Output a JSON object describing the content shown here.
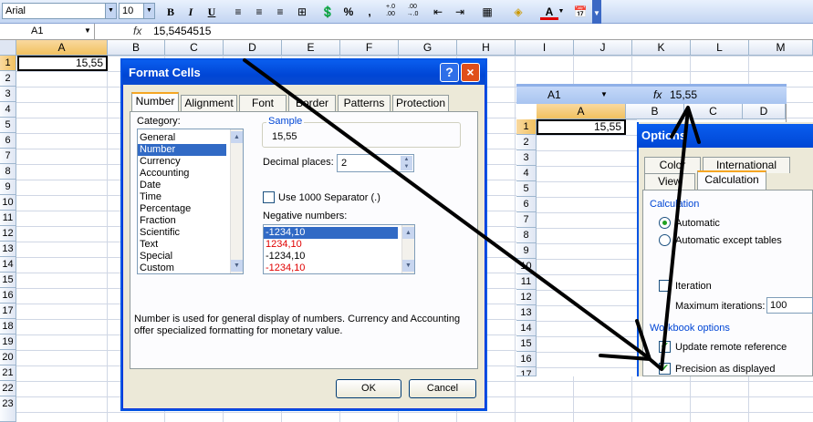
{
  "toolbar": {
    "font_name": "Arial",
    "font_size": "10",
    "bold": "B",
    "italic": "I",
    "underline": "U",
    "percent": "%",
    "comma": ",",
    "inc_decimal": "+.0\n.00",
    "dec_decimal": ".00\n+.0"
  },
  "formula_bar": {
    "name_box": "A1",
    "fx": "fx",
    "content": "15,5454515"
  },
  "sheet": {
    "columns": [
      "A",
      "B",
      "C",
      "D",
      "E",
      "F",
      "G",
      "H",
      "I",
      "J",
      "K",
      "L",
      "M"
    ],
    "rows": [
      "1",
      "2",
      "3",
      "4",
      "5",
      "6",
      "7",
      "8",
      "9",
      "10",
      "11",
      "12",
      "13",
      "14",
      "15",
      "16",
      "17",
      "18",
      "19",
      "20",
      "21",
      "22",
      "23"
    ],
    "a1_value": "15,55"
  },
  "format_cells": {
    "title": "Format Cells",
    "help": "?",
    "close": "×",
    "tabs": [
      "Number",
      "Alignment",
      "Font",
      "Border",
      "Patterns",
      "Protection"
    ],
    "category_label": "Category:",
    "categories": [
      "General",
      "Number",
      "Currency",
      "Accounting",
      "Date",
      "Time",
      "Percentage",
      "Fraction",
      "Scientific",
      "Text",
      "Special",
      "Custom"
    ],
    "sample_label": "Sample",
    "sample_value": "15,55",
    "decimal_label": "Decimal places:",
    "decimal_value": "2",
    "separator_label": "Use 1000 Separator (.)",
    "negative_label": "Negative numbers:",
    "negatives": [
      "-1234,10",
      "1234,10",
      "-1234,10",
      "-1234,10"
    ],
    "description": "Number is used for general display of numbers.  Currency and Accounting offer specialized formatting for monetary value.",
    "ok": "OK",
    "cancel": "Cancel"
  },
  "inset": {
    "name_box": "A1",
    "fx": "fx",
    "content": "15,55",
    "columns": [
      "A",
      "B",
      "C",
      "D"
    ],
    "rows": [
      "1",
      "2",
      "3",
      "4",
      "5",
      "6",
      "7",
      "8",
      "9",
      "10",
      "11",
      "12",
      "13",
      "14",
      "15",
      "16",
      "17"
    ],
    "a1_value": "15,55"
  },
  "options": {
    "title": "Options",
    "tab_color": "Color",
    "tab_international": "International",
    "tab_view": "View",
    "tab_calculation": "Calculation",
    "calc_group": "Calculation",
    "automatic": "Automatic",
    "automatic_except": "Automatic except tables",
    "iteration": "Iteration",
    "max_iterations": "Maximum iterations:",
    "max_iterations_value": "100",
    "workbook_group": "Workbook options",
    "update_remote": "Update remote reference",
    "precision": "Precision as displayed"
  }
}
